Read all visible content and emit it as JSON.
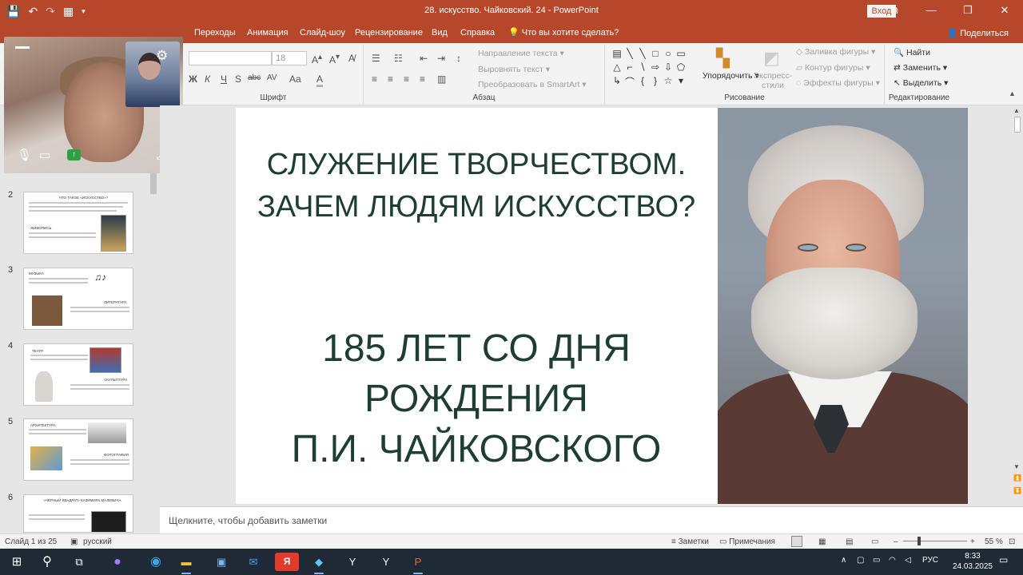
{
  "window": {
    "title": "28. искусство. Чайковский. 24  -  PowerPoint",
    "login_label": "Вход"
  },
  "ribbon_tabs": [
    "Переходы",
    "Анимация",
    "Слайд-шоу",
    "Рецензирование",
    "Вид",
    "Справка"
  ],
  "tellme": "Что вы хотите сделать?",
  "share": "Поделиться",
  "ribbon": {
    "font_size": "18",
    "font_group": "Шрифт",
    "paragraph_group": "Абзац",
    "text_direction": "Направление текста",
    "align_text": "Выровнять текст",
    "smartart": "Преобразовать в SmartArt",
    "drawing_group": "Рисование",
    "arrange": "Упорядочить",
    "quick_styles": "Экспресс-стили",
    "shape_fill": "Заливка фигуры",
    "shape_outline": "Контур фигуры",
    "shape_effects": "Эффекты фигуры",
    "find": "Найти",
    "replace": "Заменить",
    "select": "Выделить",
    "editing_group": "Редактирование"
  },
  "thumbnails": [
    {
      "num": "2",
      "title": "ЧТО ТАКОЕ «ИСКУССТВО»?",
      "sub": "ЖИВОПИСЬ"
    },
    {
      "num": "3",
      "title": "МУЗЫКА",
      "sub": "ЛИТЕРАТУРА"
    },
    {
      "num": "4",
      "title": "ТЕАТР",
      "sub": "СКУЛЬПТУРА"
    },
    {
      "num": "5",
      "title": "АРХИТЕКТУРА",
      "sub": "ФОТОГРАФИЯ"
    },
    {
      "num": "6",
      "title": "«ЧЁРНЫЙ КВАДРАТ» КАЗИМИРА МАЛЕВИЧА",
      "sub": ""
    }
  ],
  "slide": {
    "title_line1": "СЛУЖЕНИЕ ТВОРЧЕСТВОМ.",
    "title_line2": "ЗАЧЕМ ЛЮДЯМ ИСКУССТВО?",
    "sub_line1": "185 ЛЕТ СО ДНЯ",
    "sub_line2": "РОЖДЕНИЯ",
    "sub_line3": "П.И. ЧАЙКОВСКОГО"
  },
  "notes_placeholder": "Щелкните, чтобы добавить заметки",
  "status": {
    "slide_counter": "Слайд 1 из 25",
    "language": "русский",
    "notes": "Заметки",
    "comments": "Примечания",
    "zoom": "55 %"
  },
  "taskbar": {
    "lang": "РУС",
    "time": "8:33",
    "date": "24.03.2025"
  },
  "colors": {
    "accent": "#b7472a",
    "slide_text": "#1e3d33"
  }
}
